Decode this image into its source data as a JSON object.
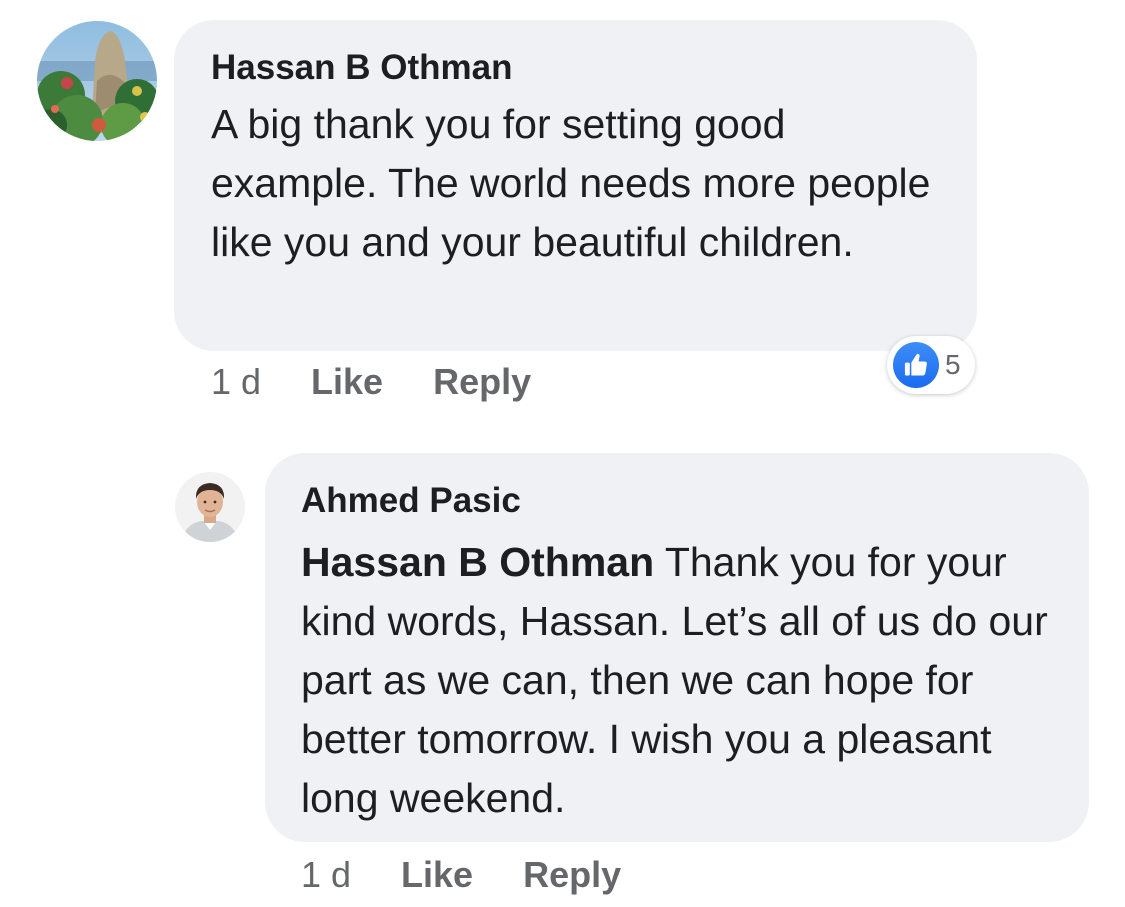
{
  "comments": [
    {
      "author": "Hassan B Othman",
      "avatar_icon": "landscape-avatar",
      "text": "A big thank you for setting good example. The world needs more people like you and your beautiful children.",
      "time": "1 d",
      "like_label": "Like",
      "reply_label": "Reply",
      "reactions": {
        "icon": "thumbs-up-icon",
        "count": "5",
        "color": "#1877f2"
      }
    },
    {
      "author": "Ahmed Pasic",
      "avatar_icon": "person-avatar",
      "mention": "Hassan B Othman",
      "text": "Thank you for your kind words, Hassan. Let’s all of us do our part as we can, then we can hope for better tomorrow. I wish you a pleasant long weekend.",
      "time": "1 d",
      "like_label": "Like",
      "reply_label": "Reply"
    }
  ],
  "colors": {
    "bubble_bg": "#f0f1f4",
    "text": "#1c1e21",
    "meta": "#65676b",
    "like_blue": "#1877f2"
  }
}
